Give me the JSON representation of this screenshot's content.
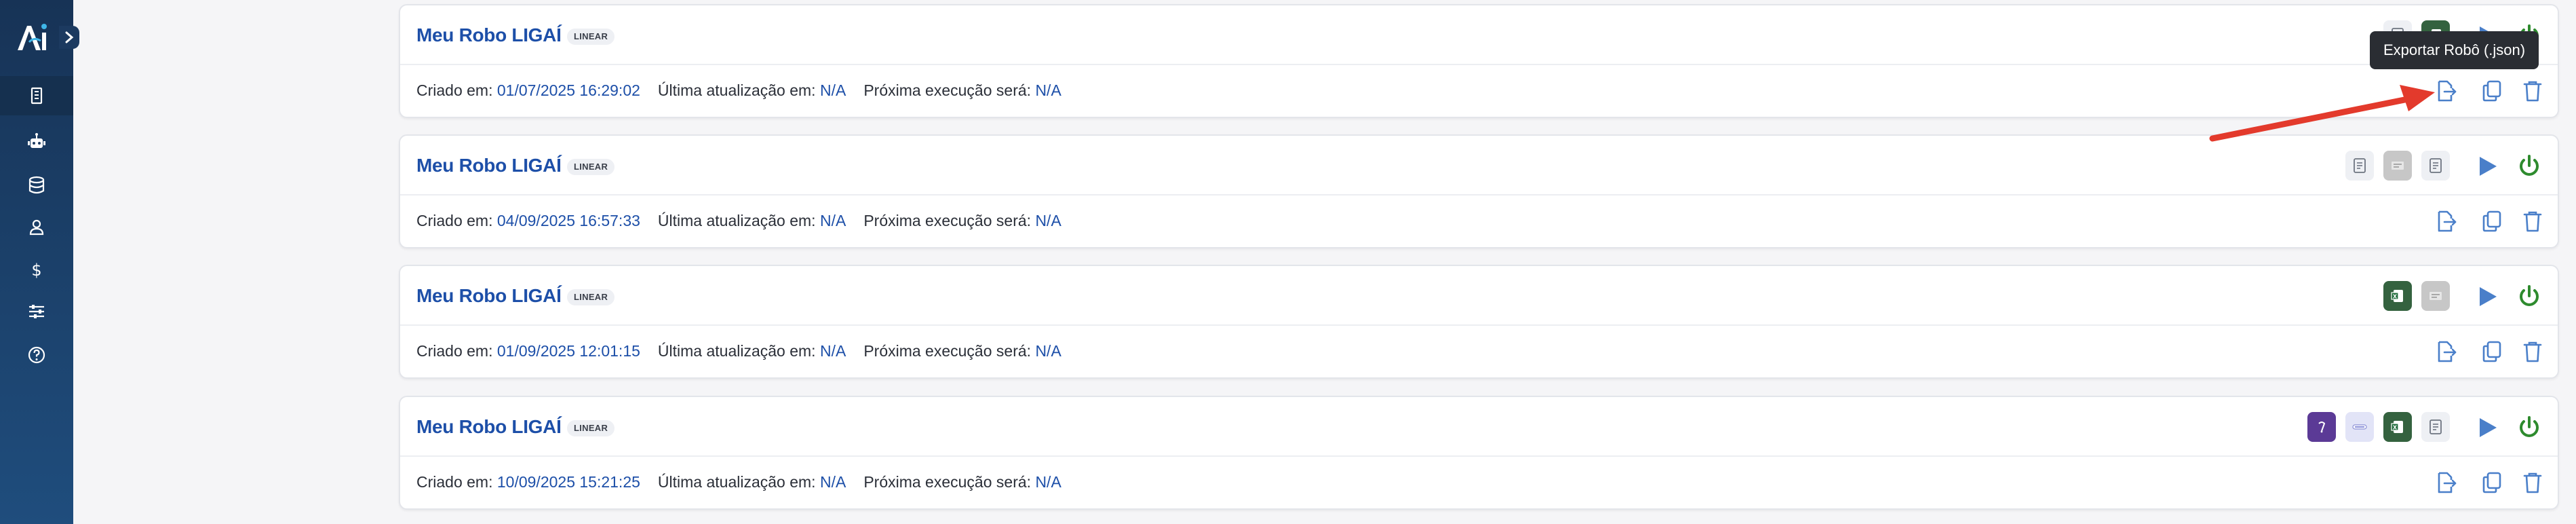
{
  "app": {
    "logo_text": "Ai"
  },
  "sidebar": {
    "items": [
      {
        "name": "building-icon",
        "active": true
      },
      {
        "name": "robot-icon",
        "active": false
      },
      {
        "name": "database-icon",
        "active": false
      },
      {
        "name": "users-icon",
        "active": false
      },
      {
        "name": "dollar-icon",
        "active": false
      },
      {
        "name": "sliders-icon",
        "active": false
      },
      {
        "name": "help-icon",
        "active": false
      }
    ]
  },
  "tooltip": "Exportar Robô (.json)",
  "labels": {
    "created": "Criado em: ",
    "updated": "Última atualização em: ",
    "next": "Próxima execução será: "
  },
  "robots": [
    {
      "title": "Meu Robo LIGAÍ",
      "type": "LINEAR",
      "created": "01/07/2025 16:29:02",
      "updated": "N/A",
      "next": "N/A",
      "apps": [
        "register-app-icon",
        "spreadsheet-app-icon"
      ]
    },
    {
      "title": "Meu Robo LIGAÍ",
      "type": "LINEAR",
      "created": "04/09/2025 16:57:33",
      "updated": "N/A",
      "next": "N/A",
      "apps": [
        "register-app-icon",
        "document-app-icon",
        "register-app-icon"
      ]
    },
    {
      "title": "Meu Robo LIGAÍ",
      "type": "LINEAR",
      "created": "01/09/2025 12:01:15",
      "updated": "N/A",
      "next": "N/A",
      "apps": [
        "spreadsheet-app-icon",
        "document-app-icon"
      ]
    },
    {
      "title": "Meu Robo LIGAÍ",
      "type": "LINEAR",
      "created": "10/09/2025 15:21:25",
      "updated": "N/A",
      "next": "N/A",
      "apps": [
        "ai-app-icon",
        "payment-app-icon",
        "spreadsheet-app-icon",
        "register-app-icon"
      ]
    }
  ],
  "colors": {
    "sidebar_top": "#173356",
    "sidebar_bottom": "#1f4d7d",
    "title_blue": "#1d4fa8",
    "play_blue": "#4a7fc9",
    "power_green": "#2e8b2e",
    "arrow_red": "#e33a2c"
  }
}
